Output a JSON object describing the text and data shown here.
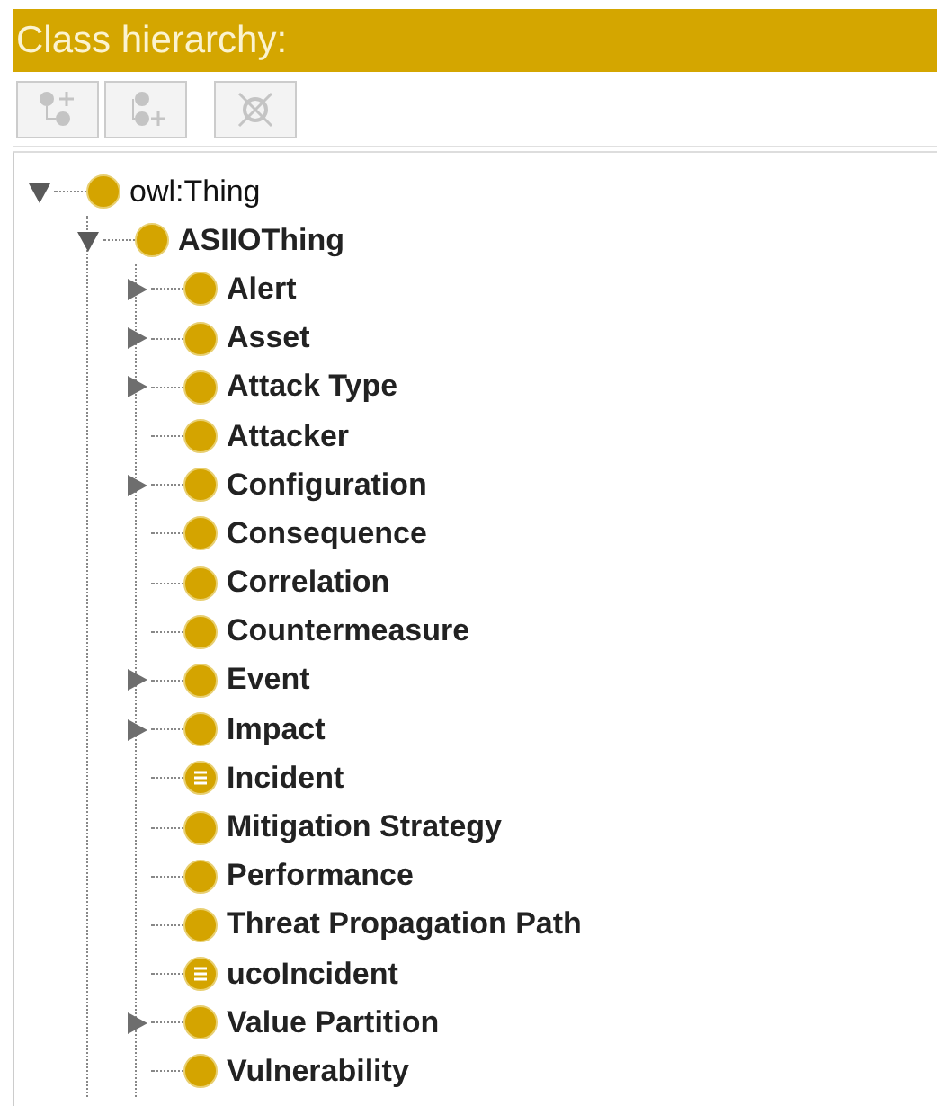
{
  "panel": {
    "title": "Class hierarchy:"
  },
  "toolbar": [
    {
      "kind": "add-subclass",
      "disabled": true
    },
    {
      "kind": "add-sibling",
      "disabled": true
    },
    {
      "kind": "delete",
      "disabled": true
    }
  ],
  "tree": [
    {
      "label": "owl:Thing",
      "kind": "class",
      "has_children": true,
      "expanded": true,
      "bold": false,
      "children": [
        {
          "label": "ASIIOThing",
          "kind": "class",
          "has_children": true,
          "expanded": true,
          "bold": true,
          "children": [
            {
              "label": "Alert",
              "kind": "class",
              "has_children": true,
              "expanded": false,
              "bold": true
            },
            {
              "label": "Asset",
              "kind": "class",
              "has_children": true,
              "expanded": false,
              "bold": true
            },
            {
              "label": "Attack Type",
              "kind": "class",
              "has_children": true,
              "expanded": false,
              "bold": true
            },
            {
              "label": "Attacker",
              "kind": "class",
              "has_children": false,
              "bold": true
            },
            {
              "label": "Configuration",
              "kind": "class",
              "has_children": true,
              "expanded": false,
              "bold": true
            },
            {
              "label": "Consequence",
              "kind": "class",
              "has_children": false,
              "bold": true
            },
            {
              "label": "Correlation",
              "kind": "class",
              "has_children": false,
              "bold": true
            },
            {
              "label": "Countermeasure",
              "kind": "class",
              "has_children": false,
              "bold": true
            },
            {
              "label": "Event",
              "kind": "class",
              "has_children": true,
              "expanded": false,
              "bold": true
            },
            {
              "label": "Impact",
              "kind": "class",
              "has_children": true,
              "expanded": false,
              "bold": true
            },
            {
              "label": "Incident",
              "kind": "defined",
              "has_children": false,
              "bold": true
            },
            {
              "label": "Mitigation Strategy",
              "kind": "class",
              "has_children": false,
              "bold": true
            },
            {
              "label": "Performance",
              "kind": "class",
              "has_children": false,
              "bold": true
            },
            {
              "label": "Threat Propagation Path",
              "kind": "class",
              "has_children": false,
              "bold": true
            },
            {
              "label": "ucoIncident",
              "kind": "defined",
              "has_children": false,
              "bold": true
            },
            {
              "label": "Value Partition",
              "kind": "class",
              "has_children": true,
              "expanded": false,
              "bold": true
            },
            {
              "label": "Vulnerability",
              "kind": "class",
              "has_children": false,
              "bold": true
            }
          ]
        }
      ]
    }
  ]
}
